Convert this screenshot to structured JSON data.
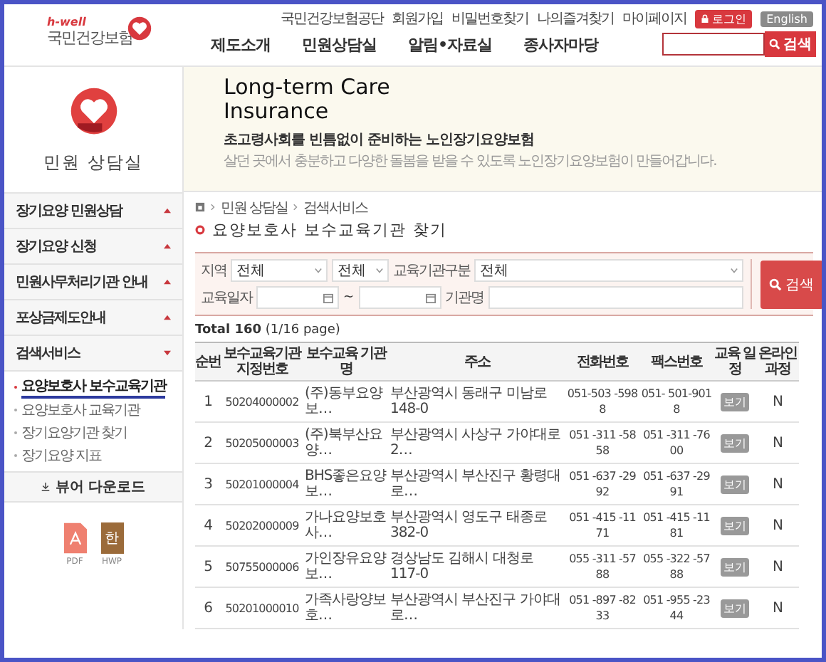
{
  "header": {
    "logo": {
      "brand": "h-well",
      "name": "국민건강보험"
    },
    "top_links": [
      "국민건강보험공단",
      "회원가입",
      "비밀번호찾기",
      "나의즐겨찾기",
      "마이페이지"
    ],
    "login_button": "로그인",
    "english_button": "English",
    "nav": [
      "제도소개",
      "민원상담실",
      "알림•자료실",
      "종사자마당"
    ],
    "search_button": "검색"
  },
  "banner": {
    "section_title": "민원 상담실",
    "heading": "Long-term Care Insurance",
    "subtitle": "초고령사회를 빈틈없이 준비하는 노인장기요양보험",
    "description": "살던 곳에서 충분하고 다양한 돌봄을 받을 수 있도록 노인장기요양보험이 만들어갑니다."
  },
  "sidebar": {
    "items": [
      {
        "label": "장기요양 민원상담",
        "expanded": false
      },
      {
        "label": "장기요양 신청",
        "expanded": false
      },
      {
        "label": "민원사무처리기관 안내",
        "expanded": false
      },
      {
        "label": "포상금제도안내",
        "expanded": false
      },
      {
        "label": "검색서비스",
        "expanded": true,
        "children": [
          {
            "label": "요양보호사 보수교육기관",
            "selected": true
          },
          {
            "label": "요양보호사 교육기관",
            "selected": false
          },
          {
            "label": "장기요양기관 찾기",
            "selected": false
          },
          {
            "label": "장기요양 지표",
            "selected": false
          }
        ]
      }
    ],
    "download_title": "뷰어 다운로드",
    "downloads": [
      {
        "kind": "pdf",
        "label": "PDF"
      },
      {
        "kind": "hwp",
        "label": "HWP",
        "glyph": "한"
      }
    ]
  },
  "breadcrumb": [
    "민원 상담실",
    "검색서비스"
  ],
  "page_title": "요양보호사 보수교육기관 찾기",
  "search_form": {
    "region_label": "지역",
    "region_value": "전체",
    "district_value": "전체",
    "institution_type_label": "교육기관구분",
    "institution_type_value": "전체",
    "date_label": "교육일자",
    "date_separator": "~",
    "name_label": "기관명",
    "search_button": "검색"
  },
  "total": "**Total 160** (1/16 page)",
  "table": {
    "columns": [
      "순번",
      "보수교육기관 지정번호",
      "보수교육 기관명",
      "주소",
      "전화번호",
      "팩스번호",
      "교육 일정",
      "온라인 과정"
    ],
    "rows": [
      {
        "no": "1",
        "code": "50204000002",
        "name": "(주)동부요양보…",
        "address": "부산광역시 동래구 미남로 148-0",
        "phone": "051-503 -5988",
        "fax": "051- 501-9018",
        "schedule": "보기",
        "online": "N"
      },
      {
        "no": "2",
        "code": "50205000003",
        "name": "(주)북부산요양…",
        "address": "부산광역시 사상구 가야대로 2…",
        "phone": "051 -311 -5858",
        "fax": "051 -311 -7600",
        "schedule": "보기",
        "online": "N"
      },
      {
        "no": "3",
        "code": "50201000004",
        "name": "BHS좋은요양보…",
        "address": "부산광역시 부산진구 황령대로…",
        "phone": "051 -637 -2992",
        "fax": "051 -637 -2991",
        "schedule": "보기",
        "online": "N"
      },
      {
        "no": "4",
        "code": "50202000009",
        "name": "가나요양보호사…",
        "address": "부산광역시 영도구 태종로 382-0",
        "phone": "051 -415 -1171",
        "fax": "051 -415 -1181",
        "schedule": "보기",
        "online": "N"
      },
      {
        "no": "5",
        "code": "50755000006",
        "name": "가인장유요양보…",
        "address": "경상남도 김해시 대청로 117-0",
        "phone": "055 -311 -5788",
        "fax": "055 -322 -5788",
        "schedule": "보기",
        "online": "N"
      },
      {
        "no": "6",
        "code": "50201000010",
        "name": "가족사랑양보호…",
        "address": "부산광역시 부산진구 가야대로…",
        "phone": "051 -897 -8233",
        "fax": "051 -955 -2344",
        "schedule": "보기",
        "online": "N"
      }
    ]
  }
}
